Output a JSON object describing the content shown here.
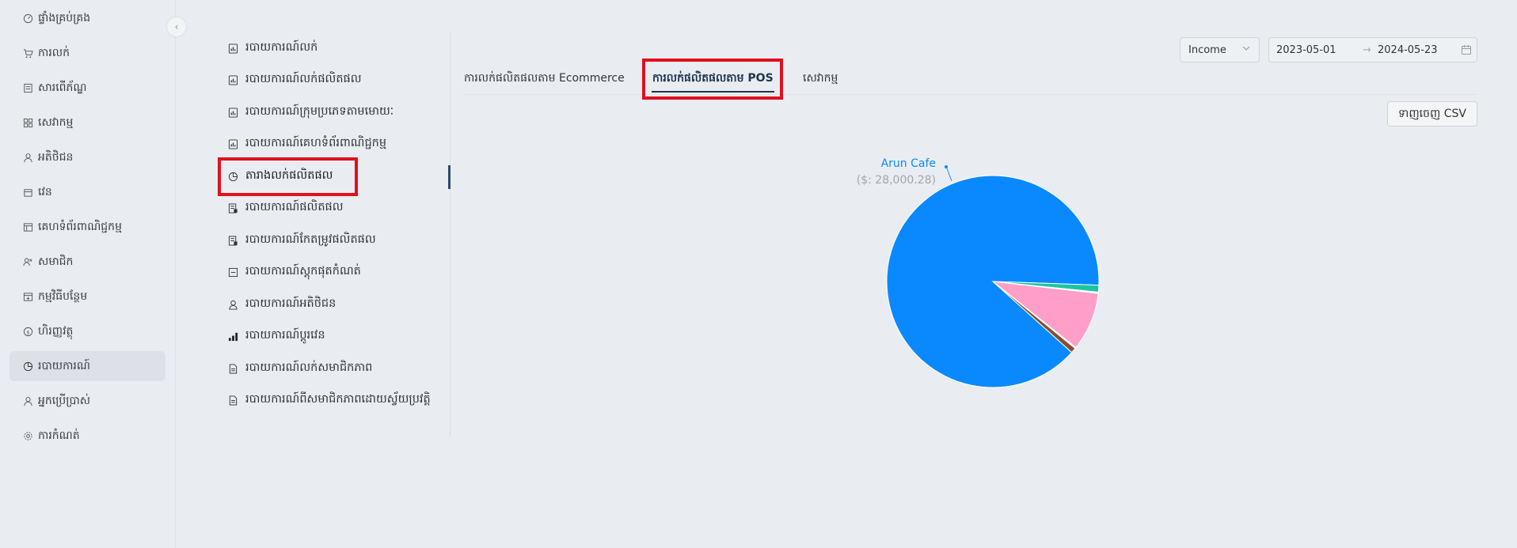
{
  "sidebar": {
    "items": [
      {
        "label": "ផ្ទាំងគ្រប់គ្រង",
        "icon": "dashboard-icon"
      },
      {
        "label": "ការលក់",
        "icon": "cart-icon"
      },
      {
        "label": "សារពើភ័ណ្ឌ",
        "icon": "inventory-icon"
      },
      {
        "label": "សេវាកម្ម",
        "icon": "services-icon"
      },
      {
        "label": "អតិថិជន",
        "icon": "customer-icon"
      },
      {
        "label": "វេន",
        "icon": "shift-icon"
      },
      {
        "label": "គេហទំព័រពាណិជ្ជកម្ម",
        "icon": "store-icon"
      },
      {
        "label": "សមាជិក",
        "icon": "member-icon"
      },
      {
        "label": "កម្មវិធីបន្ថែម",
        "icon": "addon-icon"
      },
      {
        "label": "ហិរញ្ញវត្ថុ",
        "icon": "finance-icon"
      },
      {
        "label": "របាយការណ៍",
        "icon": "report-pie-icon"
      },
      {
        "label": "អ្នកប្រើប្រាស់",
        "icon": "user-icon"
      },
      {
        "label": "ការកំណត់",
        "icon": "settings-icon"
      }
    ],
    "active_index": 10,
    "collapse_glyph": "‹"
  },
  "reports_menu": {
    "items": [
      {
        "label": "របាយការណ៍លក់",
        "icon": "bar-report-icon"
      },
      {
        "label": "របាយការណ៍លក់ផលិតផល",
        "icon": "bar-report-icon"
      },
      {
        "label": "របាយការណ៍ក្រុមប្រភេទតាមមោយៈ",
        "icon": "bar-report-icon"
      },
      {
        "label": "របាយការណ៍គេហទំព័រពាណិជ្ជកម្ម",
        "icon": "bar-report-icon"
      },
      {
        "label": "តារាងលក់ផលិតផល",
        "icon": "pie-chart-icon"
      },
      {
        "label": "របាយការណ៍ផលិតផល",
        "icon": "product-report-icon"
      },
      {
        "label": "របាយការណ៍កែតម្រូវផលិតផល",
        "icon": "product-report-icon"
      },
      {
        "label": "របាយការណ៍ស្តុកផុតកំណត់",
        "icon": "minus-box-icon"
      },
      {
        "label": "របាយការណ៍អតិថិជន",
        "icon": "person-icon"
      },
      {
        "label": "របាយការណ៍ប្តូរវេន",
        "icon": "bars-icon"
      },
      {
        "label": "របាយការណ៍លក់សមាជិកភាព",
        "icon": "doc-icon"
      },
      {
        "label": "របាយការណ៍ពីសមាជិកភាពដោយស្វ័យប្រវត្តិ",
        "icon": "doc-icon"
      }
    ],
    "active_index": 4
  },
  "tabs": [
    {
      "label": "ការលក់ផលិតផលតាម Ecommerce"
    },
    {
      "label": "ការលក់ផលិតផលតាម POS"
    },
    {
      "label": "សេវាកម្ម"
    }
  ],
  "active_tab": 1,
  "filters": {
    "type_value": "Income",
    "date_start": "2023-05-01",
    "date_end": "2024-05-23",
    "arrow": "→"
  },
  "export_button": "ទាញចេញ CSV",
  "chart_data": {
    "type": "pie",
    "series": [
      {
        "name": "Arun Cafe",
        "value": 28000.28,
        "color": "#0a89fe",
        "label": "Arun Cafe",
        "value_label": "($: 28,000.28)"
      },
      {
        "name": "",
        "value": 330,
        "color": "#1bc5a0"
      },
      {
        "name": "",
        "value": 60,
        "color": "#ffffff"
      },
      {
        "name": "",
        "value": 2800,
        "color": "#ff9ec7"
      },
      {
        "name": "",
        "value": 60,
        "color": "#ffffff"
      },
      {
        "name": "",
        "value": 250,
        "color": "#8a4b30"
      }
    ],
    "start_angle_deg": 42
  }
}
